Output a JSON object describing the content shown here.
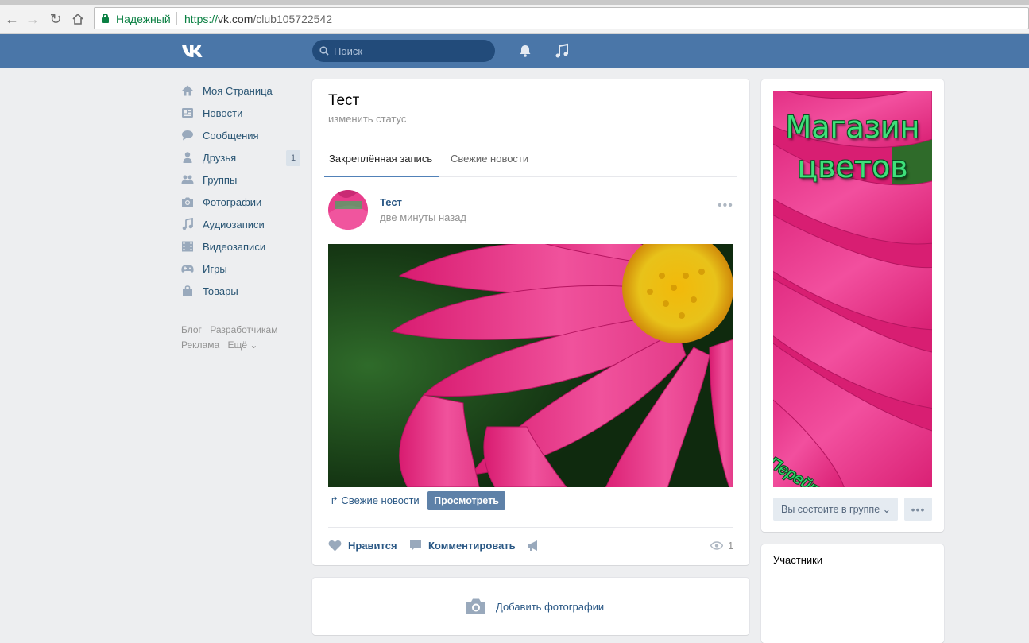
{
  "browser": {
    "secure_label": "Надежный",
    "url_proto": "https://",
    "url_host": "vk.com",
    "url_path": "/club105722542"
  },
  "header": {
    "search_placeholder": "Поиск"
  },
  "left_nav": {
    "items": [
      {
        "label": "Моя Страница",
        "icon": "home-icon"
      },
      {
        "label": "Новости",
        "icon": "news-icon"
      },
      {
        "label": "Сообщения",
        "icon": "messages-icon"
      },
      {
        "label": "Друзья",
        "icon": "friends-icon",
        "badge": "1"
      },
      {
        "label": "Группы",
        "icon": "groups-icon"
      },
      {
        "label": "Фотографии",
        "icon": "camera-icon"
      },
      {
        "label": "Аудиозаписи",
        "icon": "music-note-icon"
      },
      {
        "label": "Видеозаписи",
        "icon": "film-icon"
      },
      {
        "label": "Игры",
        "icon": "gamepad-icon"
      },
      {
        "label": "Товары",
        "icon": "shopping-bag-icon"
      }
    ],
    "footer": {
      "blog": "Блог",
      "developers": "Разработчикам",
      "ads": "Реклама",
      "more": "Ещё ⌄"
    }
  },
  "group": {
    "title": "Тест",
    "status": "изменить статус"
  },
  "tabs": {
    "pinned": "Закреплённая запись",
    "fresh": "Свежие новости"
  },
  "post": {
    "author": "Тест",
    "time": "две минуты назад",
    "repost_label": "Свежие новости",
    "view_button": "Просмотреть",
    "like_label": "Нравится",
    "comment_label": "Комментировать",
    "views_count": "1"
  },
  "add_photos": {
    "label": "Добавить фотографии"
  },
  "sidebar": {
    "banner_title_line1": "Магазин",
    "banner_title_line2": "цветов",
    "banner_link": "Перейти на наш сайт",
    "member_button": "Вы состоите в группе ⌄",
    "more_button": "•••"
  },
  "members": {
    "title": "Участники"
  },
  "colors": {
    "header_bg": "#4a76a8",
    "link": "#2a5885",
    "page_bg": "#edeef0",
    "button_primary": "#5e81a8"
  }
}
